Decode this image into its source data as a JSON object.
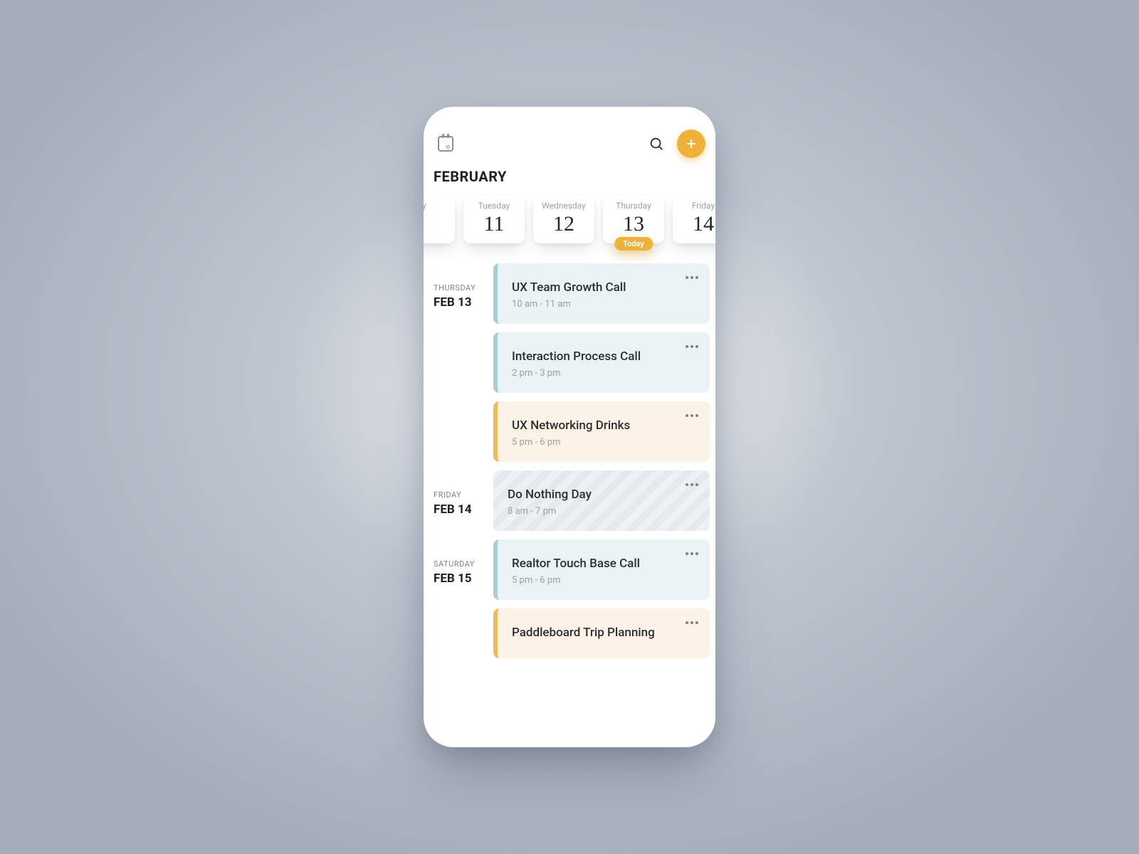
{
  "month_label": "FEBRUARY",
  "colors": {
    "accent": "#eeb23a",
    "blue_bg": "#eaf2f3",
    "orange_bg": "#fcf3e6"
  },
  "date_strip": [
    {
      "dow": "y",
      "num": ""
    },
    {
      "dow": "Tuesday",
      "num": "11"
    },
    {
      "dow": "Wednesday",
      "num": "12"
    },
    {
      "dow": "Thursday",
      "num": "13",
      "today_label": "Today"
    },
    {
      "dow": "Friday",
      "num": "14"
    }
  ],
  "agenda": [
    {
      "dow": "THURSDAY",
      "date": "FEB 13",
      "events": [
        {
          "title": "UX Team Growth Call",
          "time": "10 am - 11 am",
          "style": "blue"
        },
        {
          "title": "Interaction Process Call",
          "time": "2 pm - 3 pm",
          "style": "blue"
        },
        {
          "title": "UX Networking Drinks",
          "time": "5 pm - 6 pm",
          "style": "orange"
        }
      ]
    },
    {
      "dow": "FRIDAY",
      "date": "FEB 14",
      "events": [
        {
          "title": "Do Nothing Day",
          "time": "8 am - 7 pm",
          "style": "striped"
        }
      ]
    },
    {
      "dow": "SATURDAY",
      "date": "FEB 15",
      "events": [
        {
          "title": "Realtor Touch Base Call",
          "time": "5 pm - 6 pm",
          "style": "blue"
        },
        {
          "title": "Paddleboard Trip Planning",
          "time": "",
          "style": "orange"
        }
      ]
    }
  ]
}
